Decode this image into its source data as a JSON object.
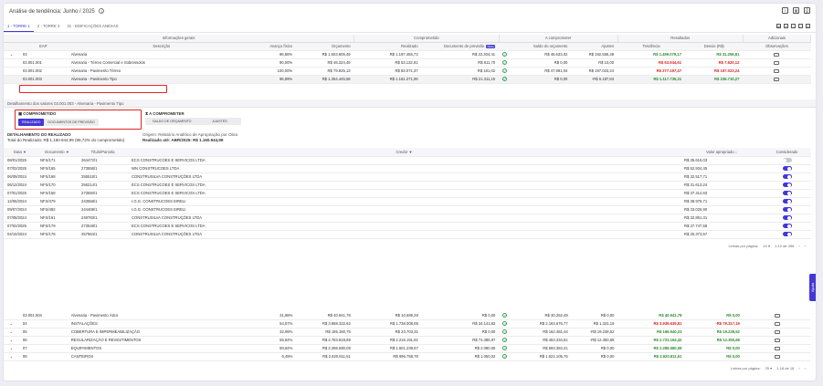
{
  "page": {
    "title": "Análise de tendência: Junho / 2025",
    "tabs": [
      "1 - TORRE 1",
      "2 - TORRE 4",
      "31 - EDIFICAÇÕES ANEXAS"
    ]
  },
  "summary": {
    "group_headers": [
      "Informações gerais",
      "Comprometido",
      "A comprometer",
      "Resultados",
      "Adicionais"
    ],
    "columns": [
      "EAP",
      "Descrição",
      "Avanço físico",
      "Orçamento",
      "Realizado",
      "Documento de previsão",
      "Saldo do orçamento",
      "Ajustes",
      "Tendência",
      "Desvio (R$)",
      "Observações"
    ],
    "new_badge": "Novo",
    "rows": [
      {
        "eap": "03",
        "descricao": "Alvenaria",
        "avanco": "96,88%",
        "orcamento": "R$ 1.503.605,49",
        "realizado": "R$ 1.197.455,73",
        "doc": "R$ 22.304,41",
        "saldo": "R$ 46.633,02",
        "ajustes": "R$ 192.555,38",
        "tendencia": "R$ 1.499.079,17",
        "desvio": "R$ 31.256,81",
        "tend_class": "green",
        "desv_class": "green"
      },
      {
        "eap": "03.001.001",
        "descricao": "Alvenaria - Térreo Comercial e Sobressolos",
        "avanco": "90,00%",
        "orcamento": "R$ 46.324,49",
        "realizado": "R$ 53.132,91",
        "doc": "R$ 811,70",
        "saldo": "R$ 0,00",
        "ajustes": "R$ 10,00",
        "tendencia": "R$ 53.944,61",
        "desvio": "R$ 7.620,12",
        "tend_class": "red",
        "desv_class": "red"
      },
      {
        "eap": "03.001.002",
        "descricao": "Alvenaria - Pavimento Térreo",
        "avanco": "100,00%",
        "orcamento": "R$ 79.925,13",
        "realizado": "R$ 83.071,37",
        "doc": "R$ 181,02",
        "saldo": "R$ 47.981,04",
        "ajustes": "R$ 197.023,24",
        "tendencia": "R$ 277.197,47",
        "desvio": "R$ 197.023,24",
        "tend_class": "red",
        "desv_class": "red"
      },
      {
        "eap": "03.001.003",
        "descricao": "Alvenaria - Pavimento Tipo",
        "avanco": "96,89%",
        "orcamento": "R$ 1.354.445,58",
        "realizado": "R$ 1.161.271,06",
        "doc": "R$ 21.311,15",
        "saldo": "R$ 0,00",
        "ajustes": "-R$ 6.187,84",
        "tendencia": "R$ 1.117.735,31",
        "desvio": "R$ 236.710,27",
        "tend_class": "green",
        "desv_class": "green"
      }
    ]
  },
  "detail": {
    "header": "Detalhamento dos valores 03.001.003 - Alvenaria - Pavimento Tipo",
    "comprometido_title": "COMPROMETIDO",
    "comprometido_tabs": [
      "REALIZADO",
      "DOCUMENTOS DE PREVISÃO"
    ],
    "acomprometer_title": "A COMPROMETER",
    "acomprometer_tabs": [
      "SALDO DE ORÇAMENTO",
      "AJUSTES"
    ],
    "realizado_title": "DETALHAMENTO DO REALIZADO",
    "realizado_total": "Total do Realizado: R$ 1.160.944,99 (99,73% do comprometido)",
    "origem": "Origem: Relatório Analítico de Apropriação por Obra",
    "realizado_ate": "Realizado até: ABR/2025: R$ 1.160.944,99",
    "columns": [
      "Data",
      "Documento",
      "Título/Parcela",
      "Credor",
      "Valor apropriado",
      "Considerado"
    ],
    "rows": [
      {
        "data": "08/01/2025",
        "doc": "NFS/171",
        "titulo": "264472/1",
        "credor": "ECS CONSTRUCOES E SERVICOS LTDA",
        "valor": "R$ 35.615,03",
        "on": false
      },
      {
        "data": "07/02/2025",
        "doc": "NFS/165",
        "titulo": "273558/1",
        "credor": "WN CONSTRUCOES LTDA",
        "valor": "R$ 52.934,45",
        "on": true
      },
      {
        "data": "06/09/2024",
        "doc": "NFS/168",
        "titulo": "255518/1",
        "credor": "CONSTRUSILVA CONSTRUÇÕES LTDA",
        "valor": "R$ 32.517,71",
        "on": true
      },
      {
        "data": "06/12/2024",
        "doc": "NFS/170",
        "titulo": "256214/1",
        "credor": "ECS CONSTRUCOES E SERVICOS LTDA",
        "valor": "R$ 31.613,24",
        "on": true
      },
      {
        "data": "07/01/2025",
        "doc": "NFS/158",
        "titulo": "273550/1",
        "credor": "ECS CONSTRUCOES E SERVICOS LTDA",
        "valor": "R$ 37.314,63",
        "on": true
      },
      {
        "data": "12/06/2024",
        "doc": "NFS/479",
        "titulo": "243558/1",
        "credor": "I.G.G. CONSTRUCOES EIRELI",
        "valor": "R$ 38.975,71",
        "on": true
      },
      {
        "data": "09/07/2024",
        "doc": "NFS/482",
        "titulo": "244469/1",
        "credor": "I.G.G. CONSTRUCOES EIRELI",
        "valor": "R$ 33.025,90",
        "on": true
      },
      {
        "data": "07/08/2024",
        "doc": "NFS/161",
        "titulo": "249783/1",
        "credor": "CONSTRUSILVA CONSTRUÇÕES LTDA",
        "valor": "R$ 32.851,31",
        "on": true
      },
      {
        "data": "07/02/2025",
        "doc": "NFS/179",
        "titulo": "273548/1",
        "credor": "ECS CONSTRUCOES E SERVICOS LTDA",
        "valor": "R$ 27.747,56",
        "on": true
      },
      {
        "data": "04/10/2024",
        "doc": "NFS/178",
        "titulo": "257964/1",
        "credor": "CONSTRUSILVA CONSTRUÇÕES LTDA",
        "valor": "R$ 25.373,57",
        "on": true
      }
    ],
    "pagination": {
      "label": "Linhas por página:",
      "size": "10",
      "range": "1-10 de 496"
    }
  },
  "bottom": {
    "rows": [
      {
        "eap": "03.001.004",
        "descricao": "Alvenaria - Pavimento Ático",
        "avanco": "31,88%",
        "orcamento": "R$ 40.941,78",
        "realizado": "R$ 10.689,29",
        "doc": "R$ 0,00",
        "saldo": "R$ 30.252,49",
        "ajustes": "R$ 0,00",
        "tendencia": "R$ 40.941,78",
        "desvio": "R$ 0,00",
        "tend_class": "green",
        "desv_class": "green",
        "check": true
      },
      {
        "eap": "04",
        "descricao": "INSTALAÇÕES",
        "avanco": "54,57%",
        "orcamento": "R$ 3.868.322,62",
        "realizado": "R$ 1.738.008,05",
        "doc": "R$ 34.141,83",
        "saldo": "R$ 2.163.676,77",
        "ajustes": "R$ 1.331,16",
        "tendencia": "R$ 3.939.639,81",
        "desvio": "-R$ 79.317,19",
        "tend_class": "red",
        "desv_class": "red",
        "check": false
      },
      {
        "eap": "05",
        "descricao": "COBERTURA E IMPERMEABILIZAÇÃO",
        "avanco": "32,99%",
        "orcamento": "R$ 185.180,75",
        "realizado": "R$ 23.703,31",
        "doc": "R$ 0,00",
        "saldo": "R$ 162.481,44",
        "ajustes": "-R$ 19.238,52",
        "tendencia": "R$ 166.940,23",
        "desvio": "R$ 19.238,52",
        "tend_class": "green",
        "desv_class": "green",
        "check": false
      },
      {
        "eap": "06",
        "descricao": "REGULARIZAÇÃO E REVESTIMENTOS",
        "avanco": "55,84%",
        "orcamento": "R$ 2.783.819,69",
        "realizado": "R$ 2.216.191,81",
        "doc": "R$ 74.386,97",
        "saldo": "R$ 453.334,81",
        "ajustes": "-R$ 12.350,68",
        "tendencia": "R$ 2.731.164,42",
        "desvio": "R$ 12.350,68",
        "tend_class": "green",
        "desv_class": "green",
        "check": false
      },
      {
        "eap": "07",
        "descricao": "EQUIPAMENTOS",
        "avanco": "80,84%",
        "orcamento": "R$ 2.286.580,08",
        "realizado": "R$ 1.601.239,67",
        "doc": "R$ 2.080,05",
        "saldo": "R$ 593.384,41",
        "ajustes": "R$ 0,00",
        "tendencia": "R$ 2.286.580,08",
        "desvio": "R$ 0,00",
        "tend_class": "green",
        "desv_class": "green",
        "check": false
      },
      {
        "eap": "08",
        "descricao": "CANTEIROS",
        "avanco": "6,49%",
        "orcamento": "R$ 2.620.811,51",
        "realizado": "R$ 996.758,78",
        "doc": "R$ 1.050,02",
        "saldo": "R$ 1.621.105,76",
        "ajustes": "R$ 0,00",
        "tendencia": "R$ 2.620.811,51",
        "desvio": "R$ 0,00",
        "tend_class": "green",
        "desv_class": "green",
        "check": false
      }
    ],
    "pagination": {
      "label": "Linhas por página:",
      "size": "25",
      "range": "1-18 de 18"
    }
  },
  "ajuda": "Ajuda"
}
